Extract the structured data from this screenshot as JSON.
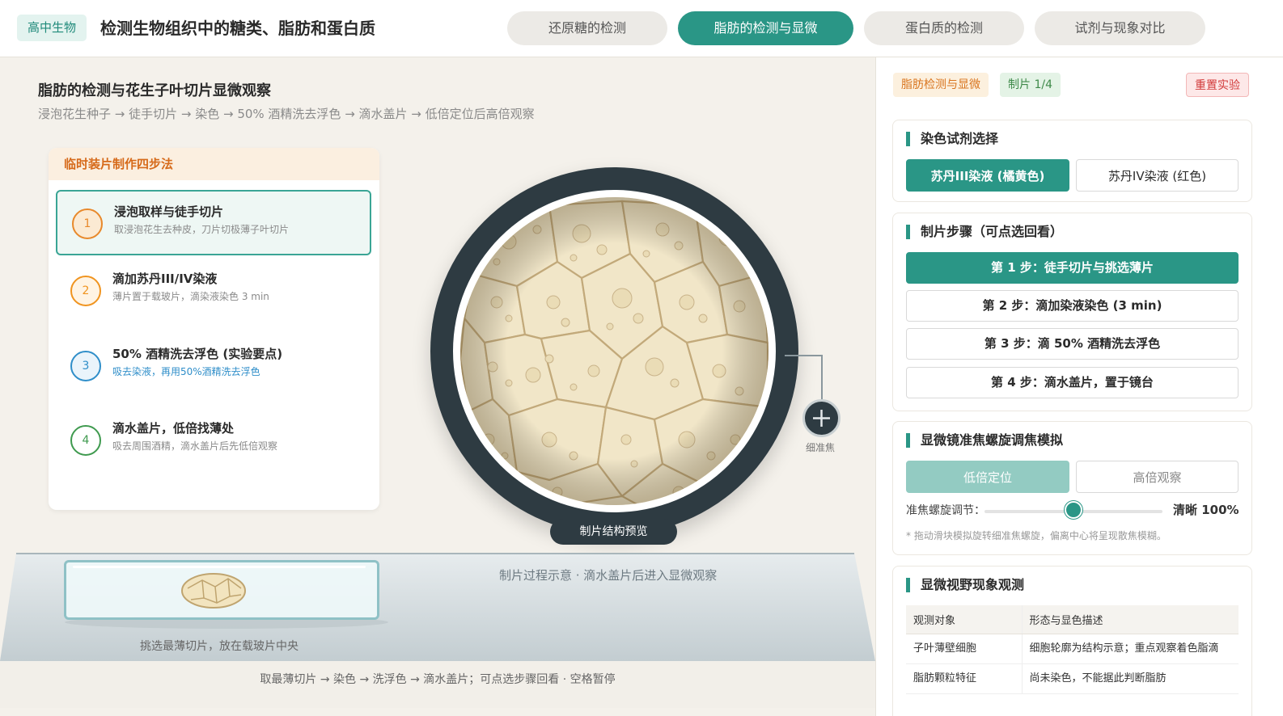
{
  "header": {
    "subject_badge": "高中生物",
    "title": "检测生物组织中的糖类、脂肪和蛋白质",
    "tabs": [
      {
        "label": "还原糖的检测",
        "active": false
      },
      {
        "label": "脂肪的检测与显微",
        "active": true
      },
      {
        "label": "蛋白质的检测",
        "active": false
      },
      {
        "label": "试剂与现象对比",
        "active": false
      }
    ]
  },
  "main": {
    "title": "脂肪的检测与花生子叶切片显微观察",
    "subtitle": "浸泡花生种子 → 徒手切片 → 染色 → 50% 酒精洗去浮色 → 滴水盖片 → 低倍定位后高倍观察",
    "steps_card": {
      "heading": "临时装片制作四步法",
      "steps": [
        {
          "num": "1",
          "title": "浸泡取样与徒手切片",
          "desc": "取浸泡花生去种皮，刀片切极薄子叶切片",
          "active": true,
          "color": "#e8892b",
          "bg": "#fbead3"
        },
        {
          "num": "2",
          "title": "滴加苏丹III/IV染液",
          "desc": "薄片置于载玻片，滴染液染色 3 min",
          "active": false,
          "color": "#f0941f",
          "bg": "#fff4e4"
        },
        {
          "num": "3",
          "title": "50% 酒精洗去浮色 (实验要点)",
          "desc": "吸去染液，再用50%酒精洗去浮色",
          "active": false,
          "color": "#2f8ec9",
          "bg": "#eaf4fb",
          "desc_color": "#2f8ec9"
        },
        {
          "num": "4",
          "title": "滴水盖片，低倍找薄处",
          "desc": "吸去周围酒精，滴水盖片后先低倍观察",
          "active": false,
          "color": "#3f9a4f",
          "bg": "#ffffff"
        }
      ]
    },
    "microscope": {
      "label": "制片结构预览",
      "focus_label": "细准焦"
    },
    "bench": {
      "slide_caption": "挑选最薄切片，放在载玻片中央",
      "process_caption": "制片过程示意 · 滴水盖片后进入显微观察"
    },
    "bottom_caption": "取最薄切片 → 染色 → 洗浮色 → 滴水盖片；可点选步骤回看 · 空格暂停"
  },
  "panel": {
    "chips": {
      "mode": "脂肪检测与显微",
      "progress": "制片 1/4",
      "reset": "重置实验"
    },
    "stain": {
      "title": "染色试剂选择",
      "options": [
        {
          "label": "苏丹III染液 (橘黄色)",
          "selected": true
        },
        {
          "label": "苏丹IV染液 (红色)",
          "selected": false
        }
      ]
    },
    "procedure": {
      "title": "制片步骤（可点选回看）",
      "steps": [
        {
          "label": "第 1 步：徒手切片与挑选薄片",
          "selected": true
        },
        {
          "label": "第 2 步：滴加染液染色 (3 min)",
          "selected": false
        },
        {
          "label": "第 3 步：滴 50% 酒精洗去浮色",
          "selected": false
        },
        {
          "label": "第 4 步：滴水盖片，置于镜台",
          "selected": false
        }
      ]
    },
    "focus": {
      "title": "显微镜准焦螺旋调焦模拟",
      "modes": [
        {
          "label": "低倍定位",
          "selected": true
        },
        {
          "label": "高倍观察",
          "selected": false
        }
      ],
      "slider_label": "准焦螺旋调节：",
      "slider_value": 0.5,
      "clarity": "清晰 100%",
      "hint": "* 拖动滑块模拟旋转细准焦螺旋，偏离中心将呈现散焦模糊。"
    },
    "observation": {
      "title": "显微视野现象观测",
      "columns": [
        "观测对象",
        "形态与显色描述"
      ],
      "rows": [
        [
          "子叶薄壁细胞",
          "细胞轮廓为结构示意；重点观察着色脂滴"
        ],
        [
          "脂肪颗粒特征",
          "尚未染色，不能据此判断脂肪"
        ]
      ]
    }
  }
}
